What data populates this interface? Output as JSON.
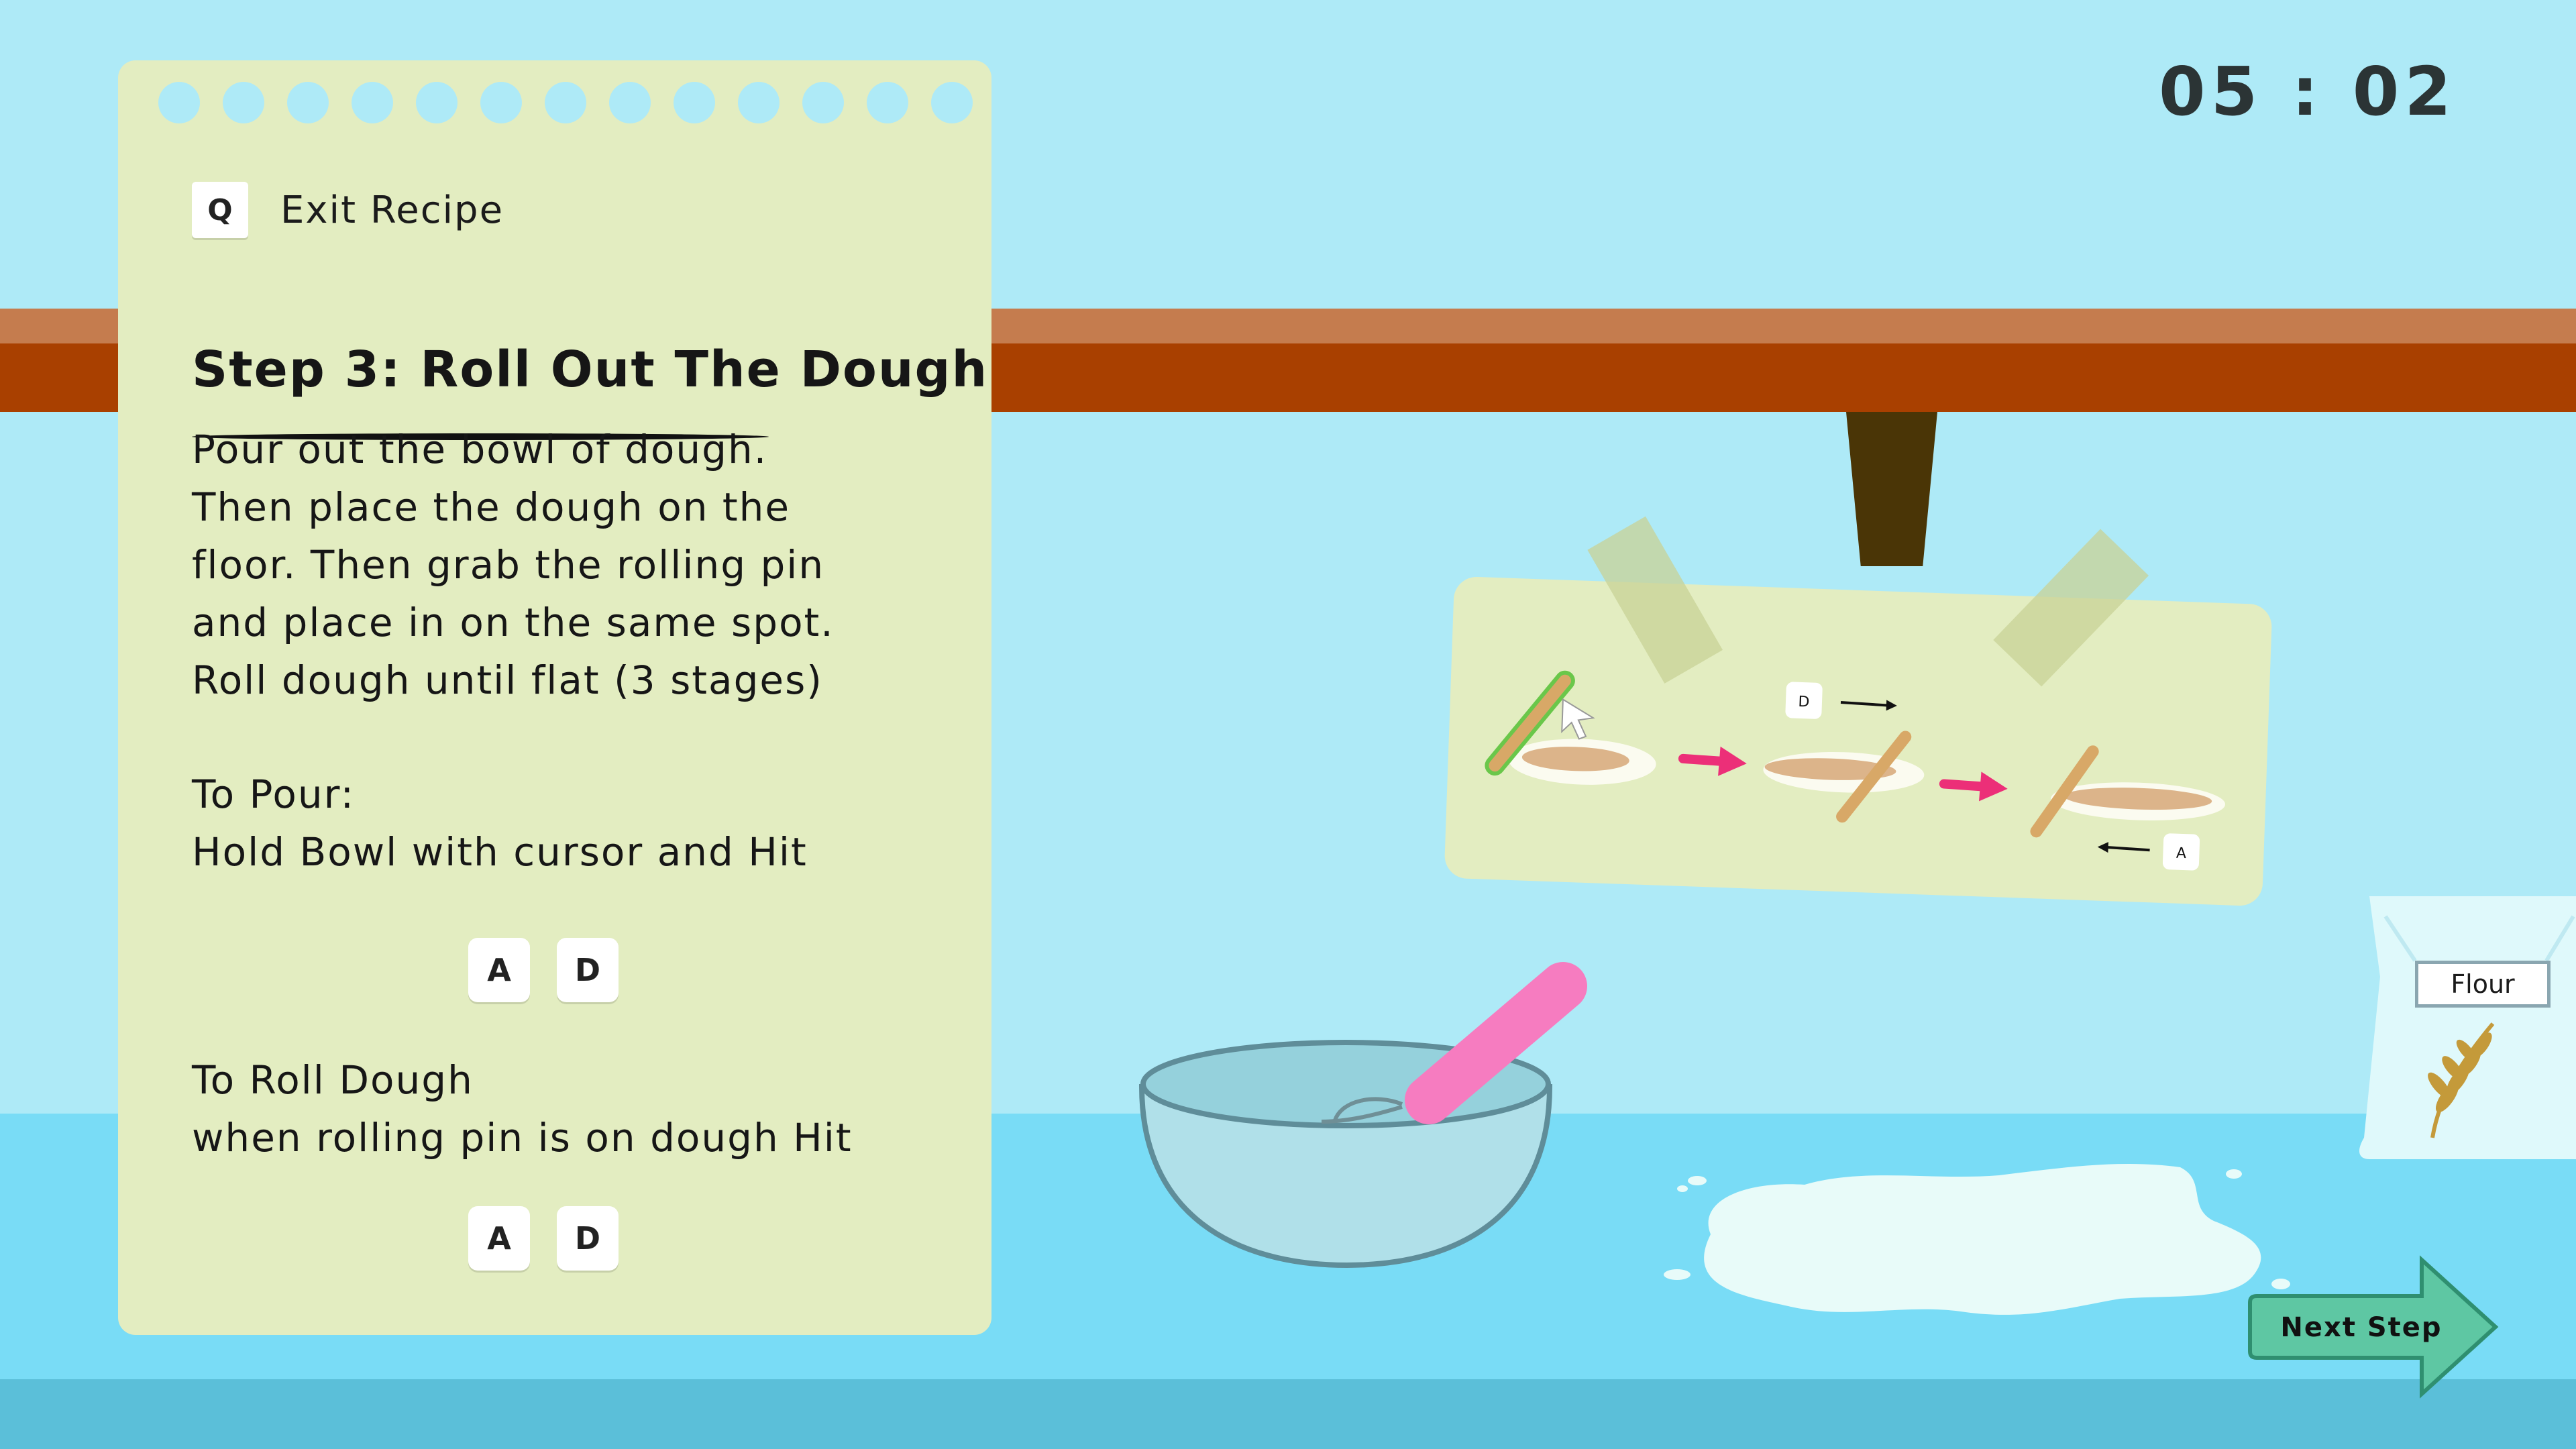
{
  "timer": {
    "display": "05 : 02"
  },
  "recipe": {
    "exit_key": "Q",
    "exit_label": "Exit Recipe",
    "step_title": "Step 3: Roll Out The Dough",
    "instructions": [
      "Pour out the bowl of dough.",
      "Then place the dough on the",
      "floor. Then grab the rolling pin",
      "and place in on the same spot.",
      "Roll dough until flat (3 stages)"
    ],
    "pour": {
      "heading": "To Pour:",
      "text": "Hold Bowl with cursor and Hit",
      "keys": [
        "A",
        "D"
      ]
    },
    "roll": {
      "heading": "To Roll Dough",
      "text": "when rolling pin is on dough Hit",
      "keys": [
        "A",
        "D"
      ]
    }
  },
  "guide": {
    "key_right": "D",
    "key_left": "A"
  },
  "flour": {
    "label": "Flour"
  },
  "next_step": {
    "label": "Next Step"
  },
  "colors": {
    "sky": "#aeeaf7",
    "shelf_top": "#c57c4e",
    "shelf_front": "#a94000",
    "card": "#e3edc1",
    "floor": "#79dcf6",
    "arrow_pink": "#ec2f78",
    "spoon_pink": "#f67cc0",
    "next_button": "#5ec7a3"
  }
}
